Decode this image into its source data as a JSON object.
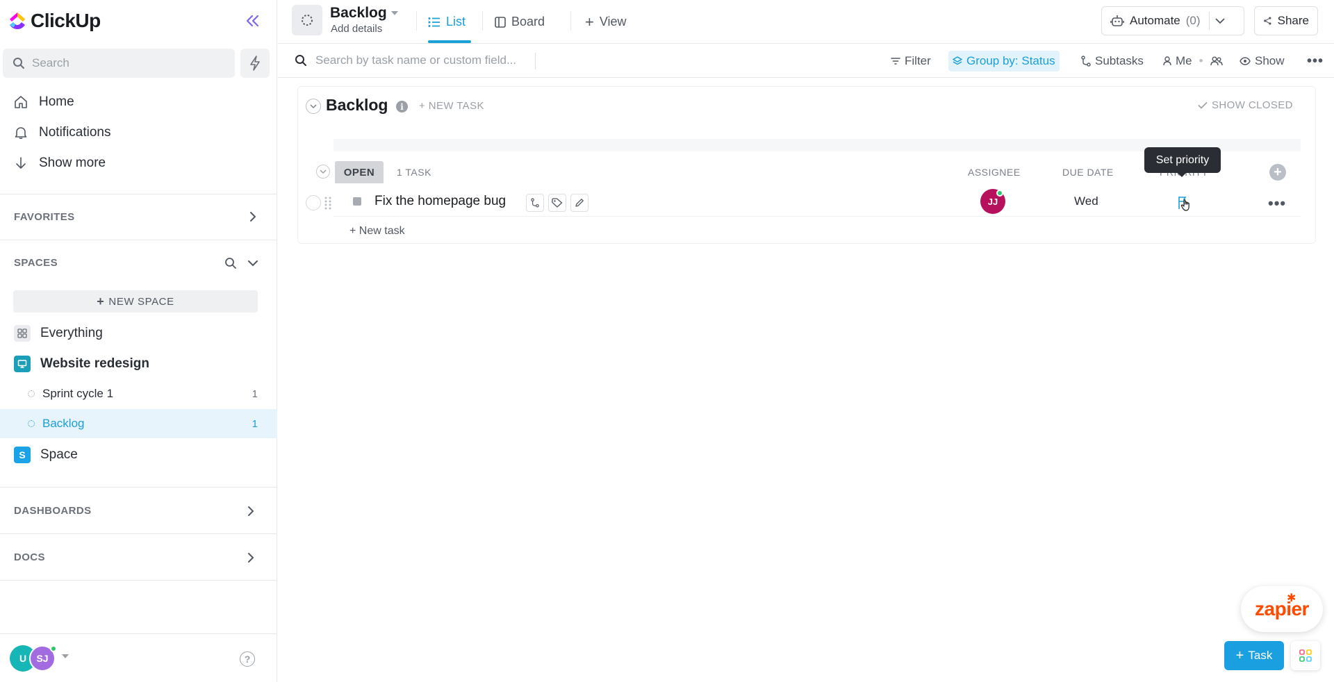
{
  "app": {
    "name": "ClickUp"
  },
  "sidebar": {
    "search_placeholder": "Search",
    "nav": [
      {
        "label": "Home",
        "icon": "home-icon"
      },
      {
        "label": "Notifications",
        "icon": "bell-icon"
      },
      {
        "label": "Show more",
        "icon": "arrow-down-icon"
      }
    ],
    "favorites_title": "FAVORITES",
    "spaces_title": "SPACES",
    "new_space_label": "NEW SPACE",
    "spaces": [
      {
        "label": "Everything",
        "icon": "grid-icon"
      },
      {
        "label": "Website redesign",
        "icon": "monitor-icon",
        "color": "#1b9fb8"
      }
    ],
    "lists": [
      {
        "label": "Sprint cycle 1",
        "count": "1",
        "active": false
      },
      {
        "label": "Backlog",
        "count": "1",
        "active": true
      }
    ],
    "space2": {
      "label": "Space",
      "initial": "S",
      "color": "#1aa3e8"
    },
    "dashboards_title": "DASHBOARDS",
    "docs_title": "DOCS",
    "footer": {
      "avatar1": "U",
      "avatar2": "SJ",
      "avatar1_color": "#16b6b6",
      "avatar2_color": "#a26be0"
    }
  },
  "header": {
    "title": "Backlog",
    "subtitle": "Add details",
    "tabs": [
      {
        "label": "List",
        "active": true
      },
      {
        "label": "Board",
        "active": false
      }
    ],
    "add_view_label": "View",
    "automate_label": "Automate",
    "automate_count": "(0)",
    "share_label": "Share"
  },
  "toolbar": {
    "search_placeholder": "Search by task name or custom field...",
    "filter_label": "Filter",
    "group_label": "Group by: Status",
    "subtasks_label": "Subtasks",
    "me_label": "Me",
    "show_label": "Show"
  },
  "main": {
    "list_title": "Backlog",
    "new_task_top": "+ NEW TASK",
    "show_closed": "SHOW CLOSED",
    "group": {
      "status": "OPEN",
      "count": "1 TASK",
      "columns": [
        "ASSIGNEE",
        "DUE DATE",
        "PRIORITY"
      ]
    },
    "tasks": [
      {
        "name": "Fix the homepage bug",
        "assignee": "JJ",
        "assignee_color": "#b5115c",
        "due": "Wed"
      }
    ],
    "tooltip": "Set priority",
    "new_task_row": "+ New task"
  },
  "floating": {
    "zapier_label": "zapier",
    "task_button": "Task"
  },
  "colors": {
    "accent": "#1a9fd8",
    "brand_purple": "#7b68ee"
  }
}
